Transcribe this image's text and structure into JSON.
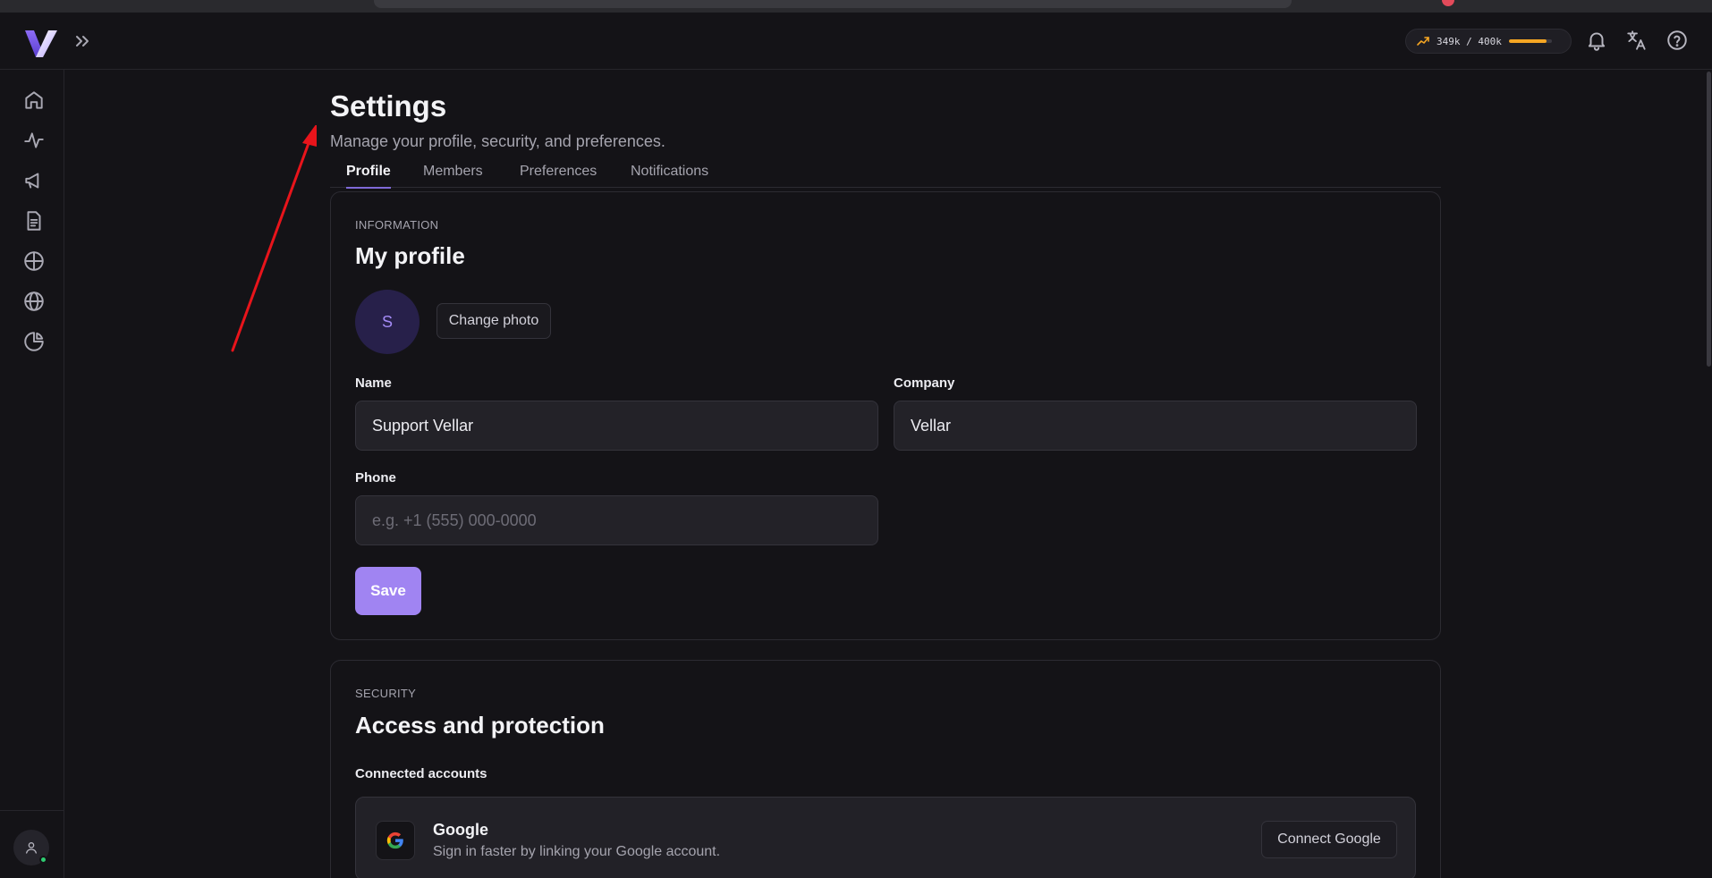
{
  "header": {
    "usage": {
      "text": "349k / 400k",
      "used": 349,
      "limit": 400,
      "fraction": 0.8725
    },
    "icons": [
      "logo-icon",
      "expand-icon",
      "trend-icon",
      "bell-icon",
      "translate-icon",
      "help-icon"
    ]
  },
  "sidebar": {
    "items": [
      {
        "name": "home",
        "icon": "home-icon"
      },
      {
        "name": "activity",
        "icon": "activity-icon"
      },
      {
        "name": "campaigns",
        "icon": "megaphone-icon"
      },
      {
        "name": "documents",
        "icon": "document-icon"
      },
      {
        "name": "target",
        "icon": "crosshair-icon"
      },
      {
        "name": "web",
        "icon": "globe-icon"
      },
      {
        "name": "analytics",
        "icon": "pie-chart-icon"
      }
    ],
    "user_icon": "user-icon"
  },
  "page": {
    "title": "Settings",
    "subtitle": "Manage your profile, security, and preferences.",
    "tabs": [
      {
        "label": "Profile",
        "active": true
      },
      {
        "label": "Members",
        "active": false
      },
      {
        "label": "Preferences",
        "active": false
      },
      {
        "label": "Notifications",
        "active": false
      }
    ]
  },
  "profile": {
    "eyebrow": "INFORMATION",
    "title": "My profile",
    "avatar_initial": "S",
    "change_photo": "Change photo",
    "name_label": "Name",
    "name_value": "Support Vellar",
    "company_label": "Company",
    "company_value": "Vellar",
    "phone_label": "Phone",
    "phone_placeholder": "e.g. +1 (555) 000-0000",
    "save": "Save"
  },
  "security": {
    "eyebrow": "SECURITY",
    "title": "Access and protection",
    "connected_label": "Connected accounts",
    "google": {
      "name": "Google",
      "description": "Sign in faster by linking your Google account.",
      "button": "Connect Google"
    }
  },
  "colors": {
    "background": "#141317",
    "accent": "#a084f2",
    "usage_bar": "#f5a623",
    "annotation_arrow": "#e8141b"
  }
}
